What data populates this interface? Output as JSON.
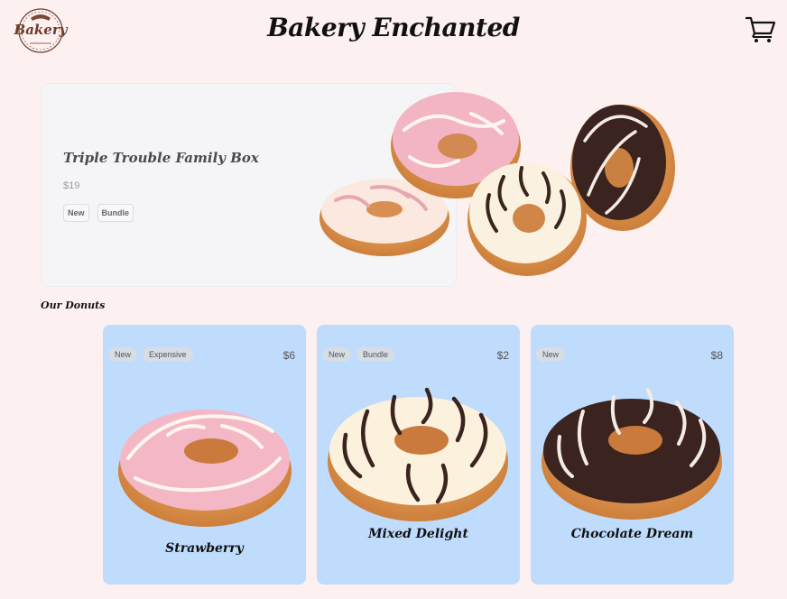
{
  "header": {
    "logo_text": "Bakery",
    "title": "Bakery Enchanted",
    "cart_icon": "cart-icon"
  },
  "featured": {
    "title": "Triple Trouble Family Box",
    "price": "$19",
    "tags": [
      "New",
      "Bundle"
    ]
  },
  "section_title": "Our Donuts",
  "products": [
    {
      "name": "Strawberry",
      "price": "$6",
      "tags": [
        "New",
        "Expensive"
      ],
      "icon": "strawberry-donut-image"
    },
    {
      "name": "Mixed Delight",
      "price": "$2",
      "tags": [
        "New",
        "Bundle"
      ],
      "icon": "mixed-delight-donut-image"
    },
    {
      "name": "Chocolate Dream",
      "price": "$8",
      "tags": [
        "New"
      ],
      "icon": "chocolate-dream-donut-image"
    }
  ],
  "colors": {
    "background": "#fdf0f0",
    "card": "#bfdcfd",
    "featured_panel": "#f5f5f7"
  }
}
